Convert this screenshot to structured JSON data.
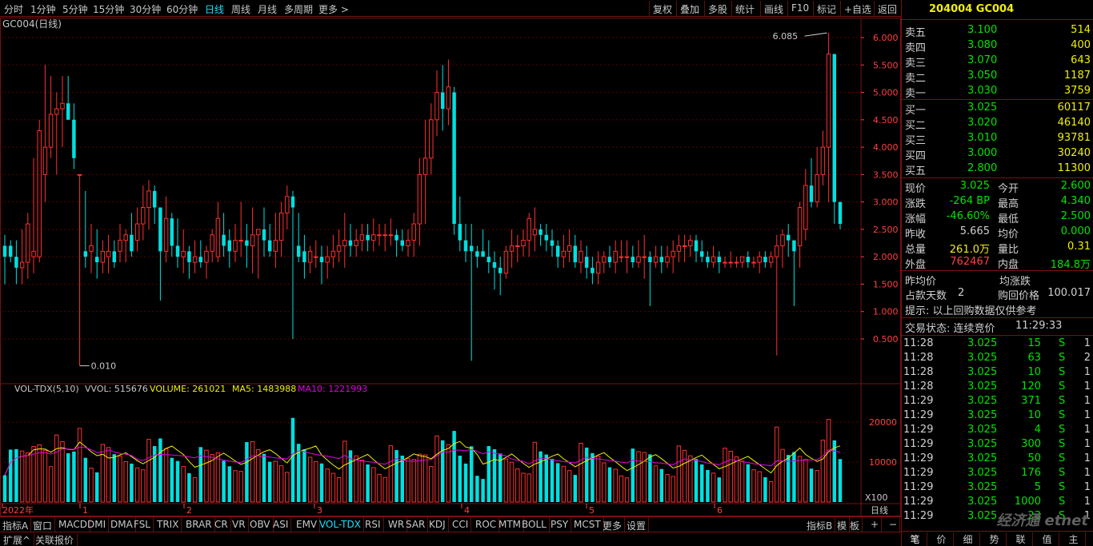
{
  "toolbar": {
    "periods": [
      "分时",
      "1分钟",
      "5分钟",
      "15分钟",
      "30分钟",
      "60分钟",
      "日线",
      "周线",
      "月线",
      "多周期",
      "更多 >"
    ],
    "active_period": "日线",
    "right": [
      "复权",
      "叠加",
      "多股",
      "统计",
      "画线",
      "F10",
      "标记",
      "+自选",
      "返回"
    ]
  },
  "chart": {
    "title": "GC004(日线)",
    "price_axis": [
      "6.000",
      "5.500",
      "5.000",
      "4.500",
      "4.000",
      "3.500",
      "3.000",
      "2.500",
      "2.000",
      "1.500",
      "1.000",
      "0.500"
    ],
    "high_label": "6.085",
    "low_label": "0.010",
    "volume_header": {
      "name": "VOL-TDX(5,10)",
      "vvol": "VVOL: 515676",
      "volume": "VOLUME: 261021",
      "ma5": "MA5: 1483988",
      "ma10": "MA10: 1221993"
    },
    "volume_axis": [
      "20000",
      "10000"
    ],
    "volume_unit": "X100",
    "date_axis": [
      "2022年",
      "1",
      "2",
      "3",
      "4",
      "5",
      "6"
    ],
    "period_label": "日线"
  },
  "chart_data": {
    "type": "candlestick",
    "ylim": [
      0,
      6.3
    ],
    "ohlc": [
      [
        2.2,
        2.4,
        1.5,
        2.0
      ],
      [
        2.2,
        2.3,
        1.9,
        2.0
      ],
      [
        2.0,
        2.3,
        1.5,
        1.8
      ],
      [
        1.8,
        2.5,
        1.5,
        1.9
      ],
      [
        1.9,
        2.8,
        1.6,
        2.6
      ],
      [
        2.0,
        3.8,
        1.7,
        2.1
      ],
      [
        2.0,
        4.5,
        1.9,
        4.3
      ],
      [
        3.5,
        5.5,
        3.0,
        4.0
      ],
      [
        4.0,
        5.3,
        3.8,
        4.6
      ],
      [
        4.6,
        5.0,
        3.5,
        4.7
      ],
      [
        4.7,
        5.3,
        4.0,
        4.8
      ],
      [
        4.8,
        5.3,
        4.6,
        4.5
      ],
      [
        4.5,
        4.8,
        3.6,
        3.8
      ],
      [
        3.5,
        3.5,
        0.01,
        3.5
      ],
      [
        2.1,
        3.2,
        1.8,
        2.0
      ],
      [
        2.1,
        2.6,
        1.7,
        2.2
      ],
      [
        2.0,
        2.5,
        1.6,
        1.9
      ],
      [
        1.9,
        2.3,
        1.7,
        2.1
      ],
      [
        2.0,
        2.4,
        1.7,
        2.1
      ],
      [
        2.1,
        2.3,
        1.8,
        1.9
      ],
      [
        2.1,
        2.6,
        1.9,
        2.3
      ],
      [
        2.3,
        2.5,
        1.9,
        2.4
      ],
      [
        2.4,
        2.8,
        2.0,
        2.1
      ],
      [
        2.3,
        2.9,
        2.1,
        2.6
      ],
      [
        2.6,
        3.3,
        2.3,
        2.9
      ],
      [
        2.9,
        3.4,
        2.5,
        3.2
      ],
      [
        3.2,
        3.3,
        2.6,
        2.9
      ],
      [
        2.9,
        2.9,
        1.2,
        2.1
      ],
      [
        2.1,
        3.1,
        1.9,
        2.7
      ],
      [
        2.7,
        2.8,
        2.0,
        2.2
      ],
      [
        2.2,
        2.7,
        1.8,
        2.0
      ],
      [
        2.0,
        2.5,
        1.7,
        2.1
      ],
      [
        2.1,
        2.2,
        1.6,
        1.9
      ],
      [
        1.9,
        2.3,
        1.7,
        2.0
      ],
      [
        2.0,
        2.3,
        1.8,
        1.9
      ],
      [
        1.9,
        2.2,
        1.6,
        2.1
      ],
      [
        2.1,
        2.5,
        1.9,
        2.4
      ],
      [
        2.0,
        3.0,
        1.9,
        2.7
      ],
      [
        2.4,
        2.8,
        2.0,
        2.2
      ],
      [
        2.3,
        2.5,
        1.8,
        2.1
      ],
      [
        2.1,
        2.6,
        1.9,
        2.3
      ],
      [
        2.3,
        3.0,
        2.0,
        2.3
      ],
      [
        2.3,
        2.6,
        1.8,
        2.2
      ],
      [
        2.2,
        2.9,
        1.7,
        2.4
      ],
      [
        2.4,
        2.5,
        1.6,
        2.5
      ],
      [
        2.5,
        2.9,
        2.0,
        2.3
      ],
      [
        2.3,
        2.6,
        2.0,
        2.1
      ],
      [
        2.1,
        2.8,
        1.8,
        2.3
      ],
      [
        2.3,
        3.0,
        2.0,
        2.8
      ],
      [
        2.8,
        3.3,
        2.5,
        3.1
      ],
      [
        3.1,
        3.2,
        0.5,
        2.9
      ],
      [
        2.2,
        2.8,
        1.9,
        2.0
      ],
      [
        2.1,
        2.4,
        1.6,
        1.9
      ],
      [
        1.9,
        2.2,
        1.7,
        2.1
      ],
      [
        2.0,
        2.3,
        1.8,
        2.0
      ],
      [
        2.0,
        2.2,
        1.5,
        1.9
      ],
      [
        1.9,
        2.2,
        1.6,
        2.0
      ],
      [
        2.0,
        2.4,
        1.8,
        2.1
      ],
      [
        2.1,
        2.5,
        1.9,
        2.2
      ],
      [
        2.2,
        2.8,
        1.8,
        2.3
      ],
      [
        2.3,
        2.6,
        2.0,
        2.2
      ],
      [
        2.2,
        2.5,
        2.0,
        2.3
      ],
      [
        2.3,
        2.6,
        2.1,
        2.4
      ],
      [
        2.4,
        2.6,
        2.1,
        2.3
      ],
      [
        2.3,
        2.7,
        2.1,
        2.4
      ],
      [
        2.4,
        2.6,
        2.2,
        2.4
      ],
      [
        2.4,
        2.6,
        2.1,
        2.4
      ],
      [
        2.4,
        2.7,
        2.2,
        2.4
      ],
      [
        2.4,
        2.5,
        2.0,
        2.3
      ],
      [
        2.3,
        2.5,
        2.1,
        2.2
      ],
      [
        2.2,
        2.5,
        2.0,
        2.3
      ],
      [
        2.3,
        2.8,
        2.0,
        2.6
      ],
      [
        2.6,
        3.8,
        2.2,
        3.5
      ],
      [
        3.5,
        4.5,
        2.6,
        3.8
      ],
      [
        3.8,
        4.8,
        3.5,
        4.5
      ],
      [
        4.5,
        5.4,
        4.2,
        5.0
      ],
      [
        5.0,
        5.5,
        4.3,
        4.7
      ],
      [
        4.7,
        5.6,
        4.4,
        5.1
      ],
      [
        5.0,
        5.1,
        2.4,
        2.6
      ],
      [
        2.6,
        3.1,
        2.1,
        2.3
      ],
      [
        2.3,
        2.6,
        1.9,
        2.1
      ],
      [
        2.2,
        2.6,
        0.1,
        2.1
      ],
      [
        2.1,
        2.2,
        1.8,
        2.0
      ],
      [
        2.1,
        2.5,
        2.0,
        2.0
      ],
      [
        2.0,
        2.3,
        1.7,
        1.9
      ],
      [
        1.9,
        2.1,
        1.4,
        1.8
      ],
      [
        1.8,
        2.0,
        1.3,
        1.7
      ],
      [
        1.7,
        2.2,
        1.6,
        2.1
      ],
      [
        2.1,
        2.5,
        1.8,
        2.2
      ],
      [
        2.2,
        2.4,
        1.9,
        2.2
      ],
      [
        2.2,
        2.5,
        2.0,
        2.3
      ],
      [
        2.3,
        2.8,
        2.0,
        2.7
      ],
      [
        2.4,
        2.9,
        2.1,
        2.5
      ],
      [
        2.5,
        2.6,
        2.2,
        2.4
      ],
      [
        2.4,
        2.6,
        2.1,
        2.3
      ],
      [
        2.3,
        2.5,
        2.0,
        2.2
      ],
      [
        2.2,
        2.3,
        1.8,
        2.0
      ],
      [
        2.0,
        2.4,
        1.8,
        2.1
      ],
      [
        2.1,
        2.5,
        1.9,
        2.2
      ],
      [
        2.2,
        2.4,
        1.8,
        1.9
      ],
      [
        1.9,
        2.3,
        1.7,
        2.1
      ],
      [
        2.0,
        2.2,
        1.6,
        1.8
      ],
      [
        1.8,
        2.0,
        1.5,
        1.7
      ],
      [
        1.7,
        2.1,
        1.5,
        1.9
      ],
      [
        1.9,
        2.1,
        1.7,
        2.0
      ],
      [
        2.0,
        2.2,
        1.8,
        1.9
      ],
      [
        1.9,
        2.3,
        1.7,
        2.1
      ],
      [
        2.0,
        2.3,
        1.9,
        2.0
      ],
      [
        2.0,
        2.3,
        1.7,
        2.0
      ],
      [
        2.0,
        2.2,
        1.8,
        1.9
      ],
      [
        1.9,
        2.3,
        1.8,
        2.0
      ],
      [
        2.0,
        2.4,
        1.6,
        2.0
      ],
      [
        2.0,
        2.1,
        1.1,
        1.9
      ],
      [
        1.9,
        2.2,
        1.8,
        2.0
      ],
      [
        2.0,
        2.2,
        1.7,
        1.9
      ],
      [
        1.9,
        2.2,
        1.8,
        2.0
      ],
      [
        2.0,
        2.3,
        1.7,
        2.1
      ],
      [
        2.1,
        2.4,
        1.9,
        2.2
      ],
      [
        2.2,
        2.4,
        1.9,
        2.2
      ],
      [
        2.2,
        2.4,
        2.0,
        2.3
      ],
      [
        2.3,
        2.4,
        1.9,
        2.1
      ],
      [
        2.1,
        2.3,
        1.9,
        2.0
      ],
      [
        2.0,
        2.1,
        1.8,
        1.9
      ],
      [
        1.9,
        2.2,
        1.8,
        2.0
      ],
      [
        2.0,
        2.1,
        1.7,
        1.9
      ],
      [
        1.9,
        2.0,
        1.8,
        1.9
      ],
      [
        1.9,
        2.1,
        1.8,
        1.9
      ],
      [
        1.9,
        2.0,
        1.8,
        1.9
      ],
      [
        1.9,
        2.0,
        1.8,
        2.0
      ],
      [
        2.0,
        2.1,
        1.8,
        1.9
      ],
      [
        1.9,
        2.0,
        1.8,
        1.9
      ],
      [
        1.9,
        2.1,
        1.7,
        2.0
      ],
      [
        2.0,
        2.1,
        1.8,
        1.9
      ],
      [
        1.9,
        2.1,
        1.8,
        2.0
      ],
      [
        2.0,
        2.4,
        0.2,
        2.2
      ],
      [
        2.2,
        2.5,
        1.8,
        2.4
      ],
      [
        2.4,
        2.6,
        2.0,
        2.3
      ],
      [
        2.3,
        2.3,
        1.1,
        2.1
      ],
      [
        2.2,
        3.0,
        1.8,
        2.9
      ],
      [
        2.5,
        3.6,
        2.3,
        3.3
      ],
      [
        3.3,
        3.8,
        2.9,
        3.0
      ],
      [
        3.0,
        4.0,
        2.9,
        3.5
      ],
      [
        3.5,
        4.3,
        3.3,
        4.0
      ],
      [
        4.0,
        6.085,
        3.0,
        5.7
      ],
      [
        5.7,
        4.3,
        2.6,
        3.0
      ],
      [
        3.0,
        3.0,
        2.5,
        2.6
      ]
    ],
    "volume_ylim": [
      0,
      26000
    ]
  },
  "quote": {
    "code": "204004 GC004",
    "asks": [
      {
        "label": "卖五",
        "price": "3.100",
        "vol": "514"
      },
      {
        "label": "卖四",
        "price": "3.080",
        "vol": "400"
      },
      {
        "label": "卖三",
        "price": "3.070",
        "vol": "643"
      },
      {
        "label": "卖二",
        "price": "3.050",
        "vol": "1187"
      },
      {
        "label": "卖一",
        "price": "3.030",
        "vol": "3759"
      }
    ],
    "bids": [
      {
        "label": "买一",
        "price": "3.025",
        "vol": "60117"
      },
      {
        "label": "买二",
        "price": "3.020",
        "vol": "46140"
      },
      {
        "label": "买三",
        "price": "3.010",
        "vol": "93781"
      },
      {
        "label": "买四",
        "price": "3.000",
        "vol": "30240"
      },
      {
        "label": "买五",
        "price": "2.800",
        "vol": "11300"
      }
    ],
    "stats": [
      {
        "l1": "现价",
        "v1": "3.025",
        "l2": "今开",
        "v2": "2.600",
        "c1": "g",
        "c2": "g"
      },
      {
        "l1": "涨跌",
        "v1": "-264 BP",
        "l2": "最高",
        "v2": "4.340",
        "c1": "g",
        "c2": "g"
      },
      {
        "l1": "涨幅",
        "v1": "-46.60%",
        "l2": "最低",
        "v2": "2.500",
        "c1": "g",
        "c2": "g"
      },
      {
        "l1": "昨收",
        "v1": "5.665",
        "l2": "均价",
        "v2": "0.000",
        "c1": "w",
        "c2": "g"
      },
      {
        "l1": "总量",
        "v1": "261.0万",
        "l2": "量比",
        "v2": "0.31",
        "c1": "y",
        "c2": "y"
      },
      {
        "l1": "外盘",
        "v1": "762467",
        "l2": "内盘",
        "v2": "184.8万",
        "c1": "r",
        "c2": "g"
      }
    ],
    "extra": {
      "avg_label": "昨均价",
      "avg_change_label": "均涨跌",
      "days_label": "占款天数",
      "days_value": "2",
      "buyback_label": "购回价格",
      "buyback_value": "100.017",
      "hint": "提示: 以上回购数据仅供参考",
      "status_label": "交易状态: 连续竞价",
      "status_time": "11:29:33"
    },
    "ticks": [
      {
        "t": "11:28",
        "p": "3.025",
        "v": "15",
        "s": "S",
        "n": "1"
      },
      {
        "t": "11:28",
        "p": "3.025",
        "v": "63",
        "s": "S",
        "n": "2"
      },
      {
        "t": "11:28",
        "p": "3.025",
        "v": "10",
        "s": "S",
        "n": "1"
      },
      {
        "t": "11:28",
        "p": "3.025",
        "v": "120",
        "s": "S",
        "n": "1"
      },
      {
        "t": "11:29",
        "p": "3.025",
        "v": "371",
        "s": "S",
        "n": "1"
      },
      {
        "t": "11:29",
        "p": "3.025",
        "v": "10",
        "s": "S",
        "n": "1"
      },
      {
        "t": "11:29",
        "p": "3.025",
        "v": "4",
        "s": "S",
        "n": "1"
      },
      {
        "t": "11:29",
        "p": "3.025",
        "v": "300",
        "s": "S",
        "n": "1"
      },
      {
        "t": "11:29",
        "p": "3.025",
        "v": "50",
        "s": "S",
        "n": "1"
      },
      {
        "t": "11:29",
        "p": "3.025",
        "v": "176",
        "s": "S",
        "n": "1"
      },
      {
        "t": "11:29",
        "p": "3.025",
        "v": "5",
        "s": "S",
        "n": "1"
      },
      {
        "t": "11:29",
        "p": "3.025",
        "v": "1000",
        "s": "S",
        "n": "1"
      },
      {
        "t": "11:29",
        "p": "3.025",
        "v": "23",
        "s": "S",
        "n": "1"
      }
    ],
    "bottom_tabs": [
      "笔",
      "价",
      "细",
      "势",
      "联",
      "值",
      "主"
    ],
    "watermark": "经济通 etnet"
  },
  "indicator_tabs": [
    "指标A",
    "窗口",
    "MACD",
    "DMI",
    "DMA",
    "FSL",
    "TRIX",
    "BRAR",
    "CR",
    "VR",
    "OBV",
    "ASI",
    "EMV",
    "VOL-TDX",
    "RSI",
    "WR",
    "SAR",
    "KDJ",
    "CCI",
    "ROC",
    "MTM",
    "BOLL",
    "PSY",
    "MCST",
    "更多",
    "设置"
  ],
  "active_indicator": "VOL-TDX",
  "indicator_right": [
    "指标B",
    "模",
    "板",
    "+",
    "−"
  ],
  "bottom_bar": [
    "扩展^",
    "关联报价"
  ],
  "colors": {
    "up": "#ff3030",
    "down": "#00e0e0",
    "grid": "#5a0000",
    "ma5": "#f0f000",
    "ma10": "#e000e0",
    "axis": "#ff4040"
  }
}
